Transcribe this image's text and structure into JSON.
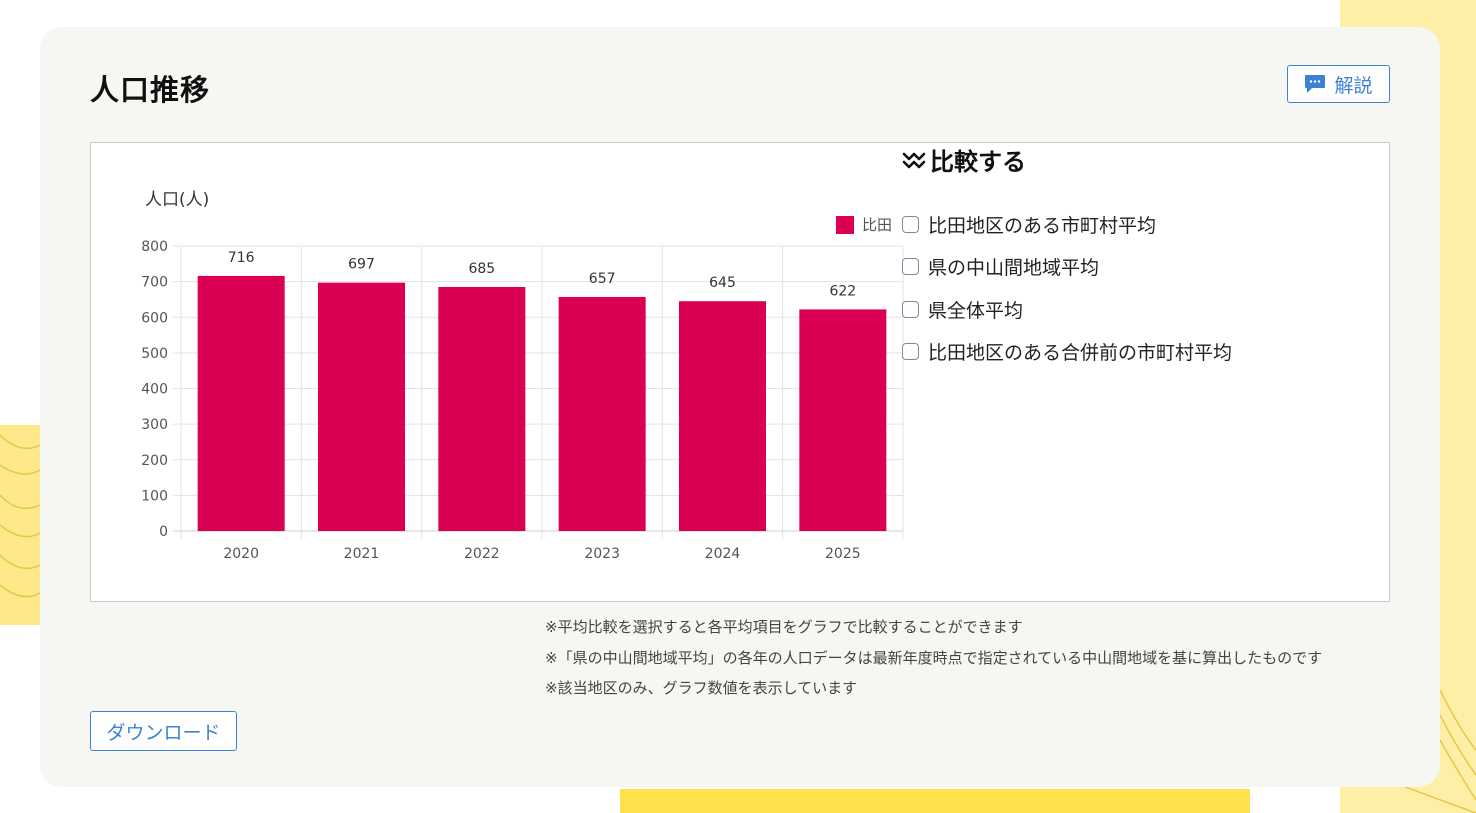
{
  "page": {
    "title": "人口推移",
    "explain_button": "解説",
    "download_button": "ダウンロード"
  },
  "compare": {
    "title": "比較する",
    "options": [
      "比田地区のある市町村平均",
      "県の中山間地域平均",
      "県全体平均",
      "比田地区のある合併前の市町村平均"
    ]
  },
  "notes": [
    "※平均比較を選択すると各平均項目をグラフで比較することができます",
    "※「県の中山間地域平均」の各年の人口データは最新年度時点で指定されている中山間地域を基に算出したものです",
    "※該当地区のみ、グラフ数値を表示しています"
  ],
  "colors": {
    "bar": "#dc0055",
    "accent": "#3b82d6"
  },
  "chart_data": {
    "type": "bar",
    "categories": [
      "2020",
      "2021",
      "2022",
      "2023",
      "2024",
      "2025"
    ],
    "series": [
      {
        "name": "比田",
        "values": [
          716,
          697,
          685,
          657,
          645,
          622
        ]
      }
    ],
    "ylabel": "人口(人)",
    "ylim": [
      0,
      800
    ],
    "yticks": [
      "0",
      "100",
      "200",
      "300",
      "400",
      "500",
      "600",
      "700",
      "800"
    ],
    "data_labels": [
      "716",
      "697",
      "685",
      "657",
      "645",
      "622"
    ],
    "legend": "top-right",
    "grid": true
  }
}
